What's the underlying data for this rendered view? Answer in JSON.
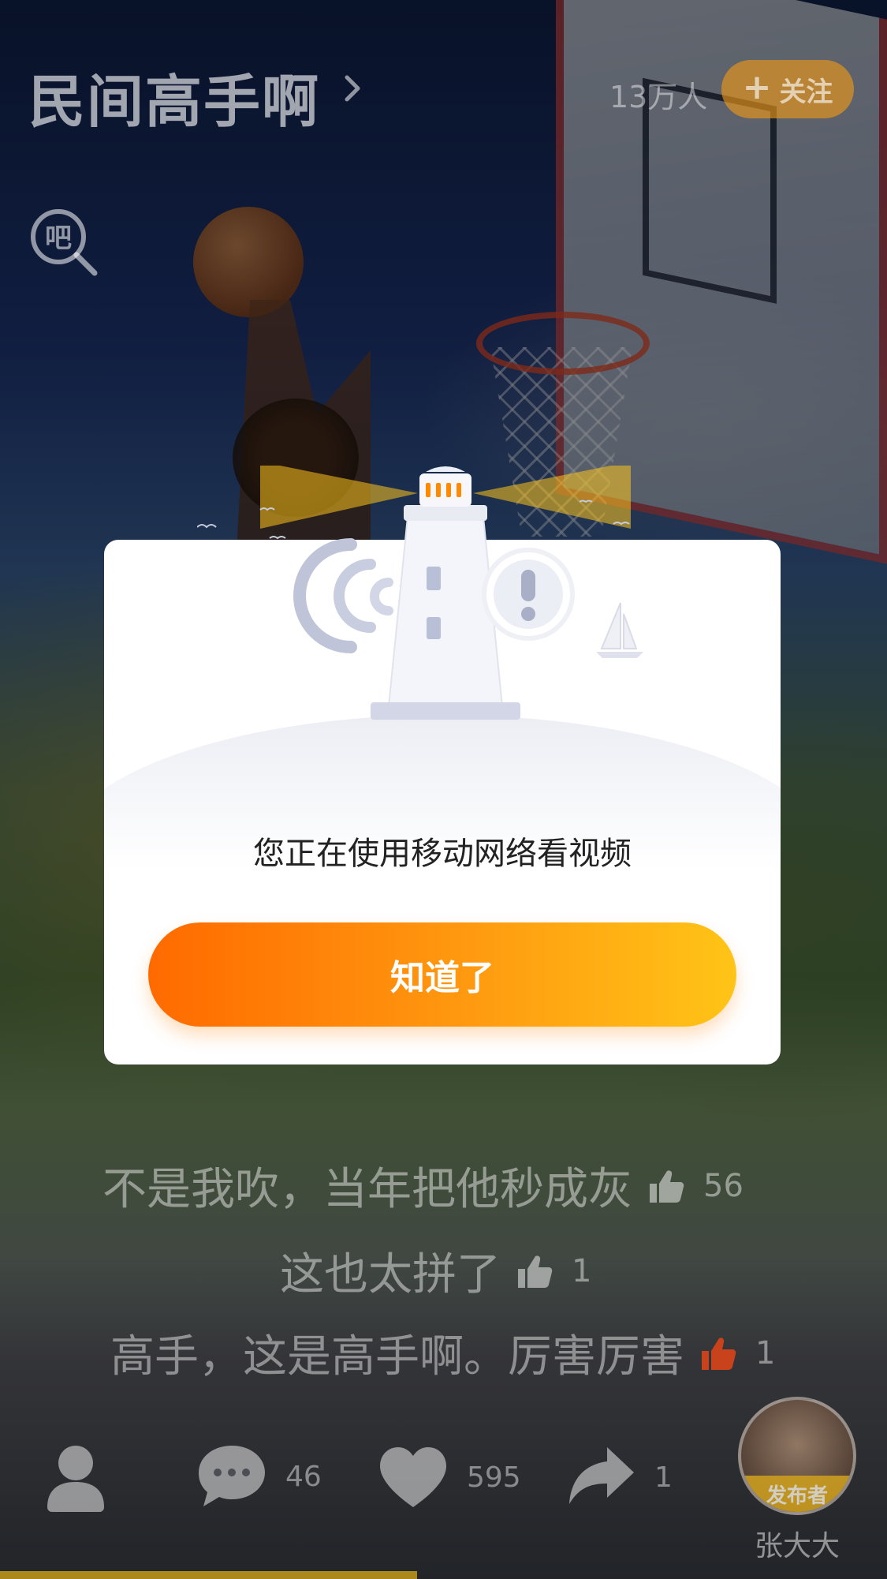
{
  "header": {
    "title": "民间高手啊",
    "member_count": "13万人",
    "follow_label": "关注",
    "follow_plus": "+",
    "tieba_icon_text": "吧"
  },
  "comments": [
    {
      "text": "不是我吹，当年把他秒成灰",
      "likes": "56",
      "liked": false
    },
    {
      "text": "这也太拼了",
      "likes": "1",
      "liked": false
    },
    {
      "text": "高手，这是高手啊。厉害厉害",
      "likes": "1",
      "liked": true
    }
  ],
  "bottom_bar": {
    "comments_count": "46",
    "likes_count": "595",
    "shares_count": "1",
    "publisher_badge": "发布者",
    "publisher_name": "张大大"
  },
  "dialog": {
    "message": "您正在使用移动网络看视频",
    "button_label": "知道了"
  },
  "playback": {
    "progress_fraction": 0.47
  },
  "colors": {
    "accent_orange": "#ff6a00",
    "accent_yellow": "#ffc417",
    "like_active": "#e8421c",
    "progress": "#e6b416"
  }
}
